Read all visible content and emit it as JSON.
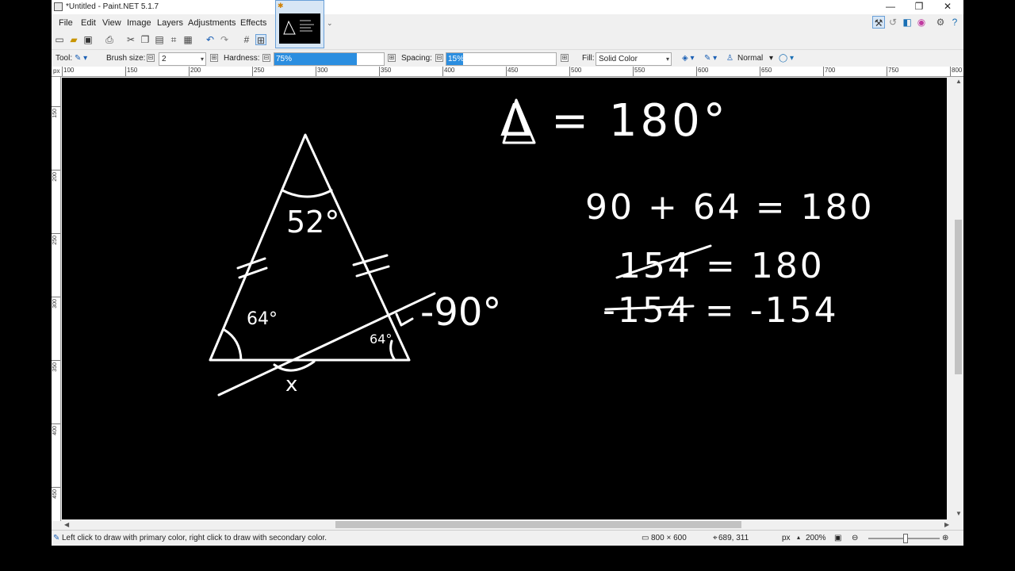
{
  "window": {
    "title": "*Untitled - Paint.NET 5.1.7",
    "minimize_glyph": "—",
    "maximize_glyph": "❐",
    "close_glyph": "✕"
  },
  "menu": {
    "file": "File",
    "edit": "Edit",
    "view": "View",
    "image": "Image",
    "layers": "Layers",
    "adjustments": "Adjustments",
    "effects": "Effects"
  },
  "quick_toolbar": [
    "new-icon",
    "open-icon",
    "save-icon",
    "print-icon",
    "cut-icon",
    "copy-icon",
    "paste-icon",
    "crop-icon",
    "deselect-icon",
    "undo-icon",
    "redo-icon",
    "grid-icon",
    "ruler-icon"
  ],
  "image_tab": {
    "star": "✱",
    "chevron": "⌄"
  },
  "right_icons": [
    "tools-icon",
    "history-icon",
    "layers-icon",
    "colors-icon",
    "settings-icon",
    "help-icon"
  ],
  "tool_options": {
    "tool_label": "Tool:",
    "brush_size_label": "Brush size:",
    "brush_size_value": "2",
    "hardness_label": "Hardness:",
    "hardness_value": "75%",
    "hardness_fraction": 0.75,
    "spacing_label": "Spacing:",
    "spacing_value": "15%",
    "spacing_fraction": 0.15,
    "fill_label": "Fill:",
    "fill_value": "Solid Color",
    "blend_mode": "Normal",
    "minus": "⊟",
    "plus": "⊞"
  },
  "ruler": {
    "unit": "px",
    "top_labels": [
      "100",
      "150",
      "200",
      "250",
      "300",
      "350",
      "400",
      "450",
      "500",
      "550",
      "600",
      "650",
      "700",
      "750",
      "800"
    ],
    "left_labels": [
      "150",
      "200",
      "250",
      "300",
      "350",
      "400",
      "450"
    ]
  },
  "canvas_text": {
    "top_angle_label": "52°",
    "left_angle_label": "64°",
    "right_angle_label": "64°",
    "right_angle_mark": "-90°",
    "x_label": "x",
    "line1": "Δ = 180°",
    "line2": "90 + 64 = 180",
    "line3": "154 = 180",
    "line4": "-154 = -154"
  },
  "status": {
    "hint": "Left click to draw with primary color, right click to draw with secondary color.",
    "image_size": "800 × 600",
    "cursor_pos": "689, 311",
    "units": "px",
    "zoom": "200%"
  }
}
